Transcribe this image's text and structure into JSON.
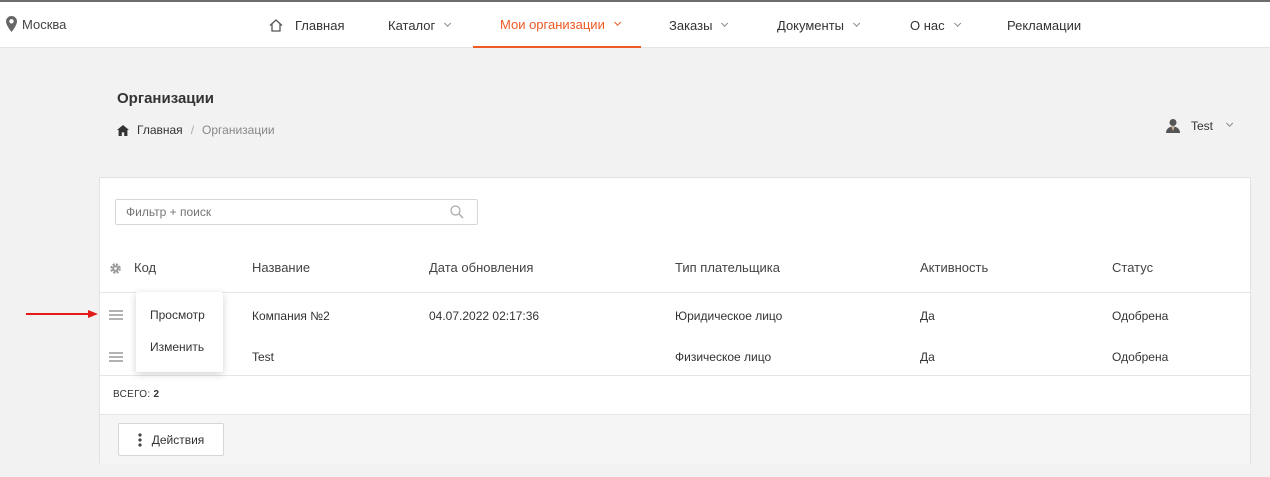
{
  "topnav": {
    "city": "Москва",
    "items": [
      {
        "label": "Главная"
      },
      {
        "label": "Каталог"
      },
      {
        "label": "Мои организации"
      },
      {
        "label": "Заказы"
      },
      {
        "label": "Документы"
      },
      {
        "label": "О нас"
      },
      {
        "label": "Рекламации"
      }
    ],
    "active_item": "Мои организации"
  },
  "page": {
    "title": "Организации",
    "breadcrumb": {
      "home": "Главная",
      "separator": "/",
      "current": "Организации"
    }
  },
  "user": {
    "name": "Test"
  },
  "table": {
    "filter_placeholder": "Фильтр + поиск",
    "columns": [
      "Код",
      "Название",
      "Дата обновления",
      "Тип плательщика",
      "Активность",
      "Статус"
    ],
    "rows": [
      {
        "code": "",
        "name": "Компания №2",
        "updated": "04.07.2022 02:17:36",
        "payer_type": "Юридическое лицо",
        "active": "Да",
        "status": "Одобрена"
      },
      {
        "code": "",
        "name": "Test",
        "updated": "",
        "payer_type": "Физическое лицо",
        "active": "Да",
        "status": "Одобрена"
      }
    ],
    "total_label": "ВСЕГО:",
    "total_value": "2",
    "actions_label": "Действия"
  },
  "row_menu": {
    "items": [
      "Просмотр",
      "Изменить"
    ]
  },
  "colors": {
    "accent": "#ee5a24",
    "annotation_arrow": "#e31b1b"
  }
}
